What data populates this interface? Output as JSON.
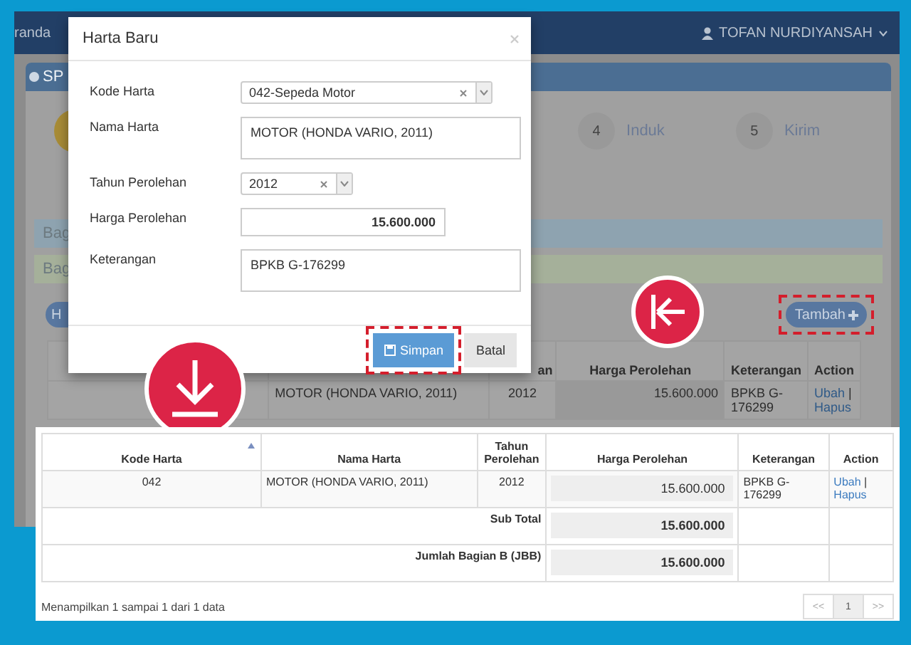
{
  "background_app": {
    "navbar": {
      "breadcrumb": "randa",
      "user": "TOFAN NURDIYANSAH"
    },
    "panel_title": "SP",
    "steps": [
      {
        "number": "4",
        "label": "Induk"
      },
      {
        "number": "5",
        "label": "Kirim"
      }
    ],
    "sections": [
      {
        "label": "Bag",
        "color": "#8ea3b0"
      },
      {
        "label": "Bag",
        "color": "#a5b09a"
      }
    ],
    "left_button": "H",
    "add_button": {
      "label": "Tambah",
      "highlighted": true
    },
    "table": {
      "columns": [
        "an",
        "Harga Perolehan",
        "Keterangan",
        "Action"
      ],
      "row": {
        "nama": "MOTOR (HONDA VARIO, 2011)",
        "tahun": "2012",
        "harga": "15.600.000",
        "keterangan": "BPKB G-176299",
        "actions": [
          "Ubah",
          "Hapus"
        ],
        "separator": "|"
      }
    }
  },
  "modal": {
    "title": "Harta Baru",
    "fields": [
      {
        "kind": "select",
        "label": "Kode Harta",
        "value": "042-Sepeda Motor"
      },
      {
        "kind": "textarea",
        "label": "Nama Harta",
        "value": "MOTOR (HONDA VARIO, 2011)"
      },
      {
        "kind": "select-small",
        "label": "Tahun Perolehan",
        "value": "2012"
      },
      {
        "kind": "number",
        "label": "Harga Perolehan",
        "value": "15.600.000"
      },
      {
        "kind": "textarea",
        "label": "Keterangan",
        "value": "BPKB G-176299"
      }
    ],
    "buttons": [
      {
        "kind": "primary",
        "label": "Simpan",
        "highlighted": true
      },
      {
        "kind": "default",
        "label": "Batal",
        "highlighted": false
      }
    ]
  },
  "callouts": [
    {
      "kind": "arrow-left"
    },
    {
      "kind": "download"
    }
  ],
  "table": {
    "columns": [
      {
        "label": "Kode Harta",
        "sorted": true
      },
      {
        "label": "Nama Harta",
        "sorted": false
      },
      {
        "label": "Tahun Perolehan",
        "sorted": false
      },
      {
        "label": "Harga Perolehan",
        "sorted": false
      },
      {
        "label": "Keterangan",
        "sorted": false
      },
      {
        "label": "Action",
        "sorted": false
      }
    ],
    "rows": [
      {
        "kode": "042",
        "nama": "MOTOR (HONDA VARIO, 2011)",
        "tahun": "2012",
        "harga": "15.600.000",
        "keterangan": "BPKB G-176299",
        "actions": [
          "Ubah",
          "Hapus"
        ],
        "separator": "|"
      }
    ],
    "totals": [
      {
        "label": "Sub Total",
        "value": "15.600.000"
      },
      {
        "label": "Jumlah Bagian B (JBB)",
        "value": "15.600.000"
      }
    ]
  },
  "footer": {
    "info": "Menampilkan 1 sampai 1 dari 1 data",
    "pagination": [
      {
        "label": "<<",
        "selected": false
      },
      {
        "label": "1",
        "selected": true
      },
      {
        "label": ">>",
        "selected": false
      }
    ]
  }
}
